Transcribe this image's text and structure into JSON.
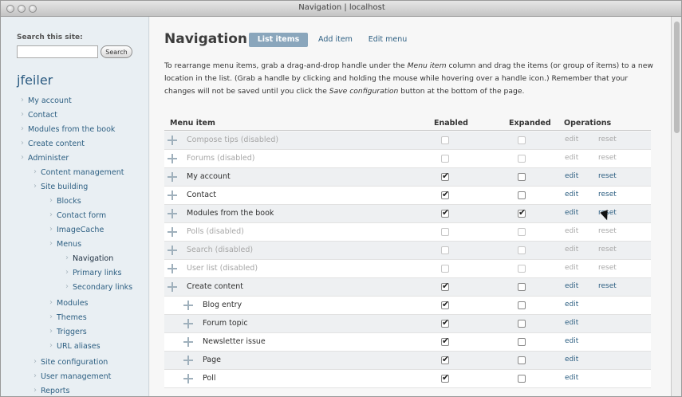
{
  "window": {
    "title": "Navigation | localhost"
  },
  "sidebar": {
    "search_label": "Search this site:",
    "search_placeholder": "",
    "search_button": "Search",
    "username": "jfeiler",
    "items": [
      {
        "label": "My account"
      },
      {
        "label": "Contact"
      },
      {
        "label": "Modules from the book"
      },
      {
        "label": "Create content"
      },
      {
        "label": "Administer"
      },
      {
        "label": "Content management"
      },
      {
        "label": "Site building"
      },
      {
        "label": "Blocks"
      },
      {
        "label": "Contact form"
      },
      {
        "label": "ImageCache"
      },
      {
        "label": "Menus"
      },
      {
        "label": "Navigation"
      },
      {
        "label": "Primary links"
      },
      {
        "label": "Secondary links"
      },
      {
        "label": "Modules"
      },
      {
        "label": "Themes"
      },
      {
        "label": "Triggers"
      },
      {
        "label": "URL aliases"
      },
      {
        "label": "Site configuration"
      },
      {
        "label": "User management"
      },
      {
        "label": "Reports"
      }
    ]
  },
  "main": {
    "title": "Navigation",
    "tabs": [
      {
        "label": "List items"
      },
      {
        "label": "Add item"
      },
      {
        "label": "Edit menu"
      }
    ],
    "help": {
      "p1": "To rearrange menu items, grab a drag-and-drop handle under the ",
      "em1": "Menu item",
      "p2": " column and drag the items (or group of items) to a new location in the list. (Grab a handle by clicking and holding the mouse while hovering over a handle icon.) Remember that your changes will not be saved until you click the ",
      "em2": "Save configuration",
      "p3": " button at the bottom of the page."
    },
    "table": {
      "headers": [
        "Menu item",
        "Enabled",
        "Expanded",
        "Operations"
      ],
      "rows": [
        {
          "label": "Compose tips (disabled)",
          "enabled": false,
          "expanded": false,
          "ops": [
            "edit",
            "reset"
          ],
          "disabled": true
        },
        {
          "label": "Forums (disabled)",
          "enabled": false,
          "expanded": false,
          "ops": [
            "edit",
            "reset"
          ],
          "disabled": true
        },
        {
          "label": "My account",
          "enabled": true,
          "expanded": false,
          "ops": [
            "edit",
            "reset"
          ],
          "disabled": false
        },
        {
          "label": "Contact",
          "enabled": true,
          "expanded": false,
          "ops": [
            "edit",
            "reset"
          ],
          "disabled": false
        },
        {
          "label": "Modules from the book",
          "enabled": true,
          "expanded": true,
          "ops": [
            "edit",
            "reset"
          ],
          "disabled": false
        },
        {
          "label": "Polls (disabled)",
          "enabled": false,
          "expanded": false,
          "ops": [
            "edit",
            "reset"
          ],
          "disabled": true
        },
        {
          "label": "Search (disabled)",
          "enabled": false,
          "expanded": false,
          "ops": [
            "edit",
            "reset"
          ],
          "disabled": true
        },
        {
          "label": "User list (disabled)",
          "enabled": false,
          "expanded": false,
          "ops": [
            "edit",
            "reset"
          ],
          "disabled": true
        },
        {
          "label": "Create content",
          "enabled": true,
          "expanded": false,
          "ops": [
            "edit",
            "reset"
          ],
          "disabled": false
        },
        {
          "label": "Blog entry",
          "enabled": true,
          "expanded": false,
          "ops": [
            "edit"
          ],
          "disabled": false
        },
        {
          "label": "Forum topic",
          "enabled": true,
          "expanded": false,
          "ops": [
            "edit"
          ],
          "disabled": false
        },
        {
          "label": "Newsletter issue",
          "enabled": true,
          "expanded": false,
          "ops": [
            "edit"
          ],
          "disabled": false
        },
        {
          "label": "Page",
          "enabled": true,
          "expanded": false,
          "ops": [
            "edit"
          ],
          "disabled": false
        },
        {
          "label": "Poll",
          "enabled": true,
          "expanded": false,
          "ops": [
            "edit"
          ],
          "disabled": false
        }
      ]
    }
  }
}
